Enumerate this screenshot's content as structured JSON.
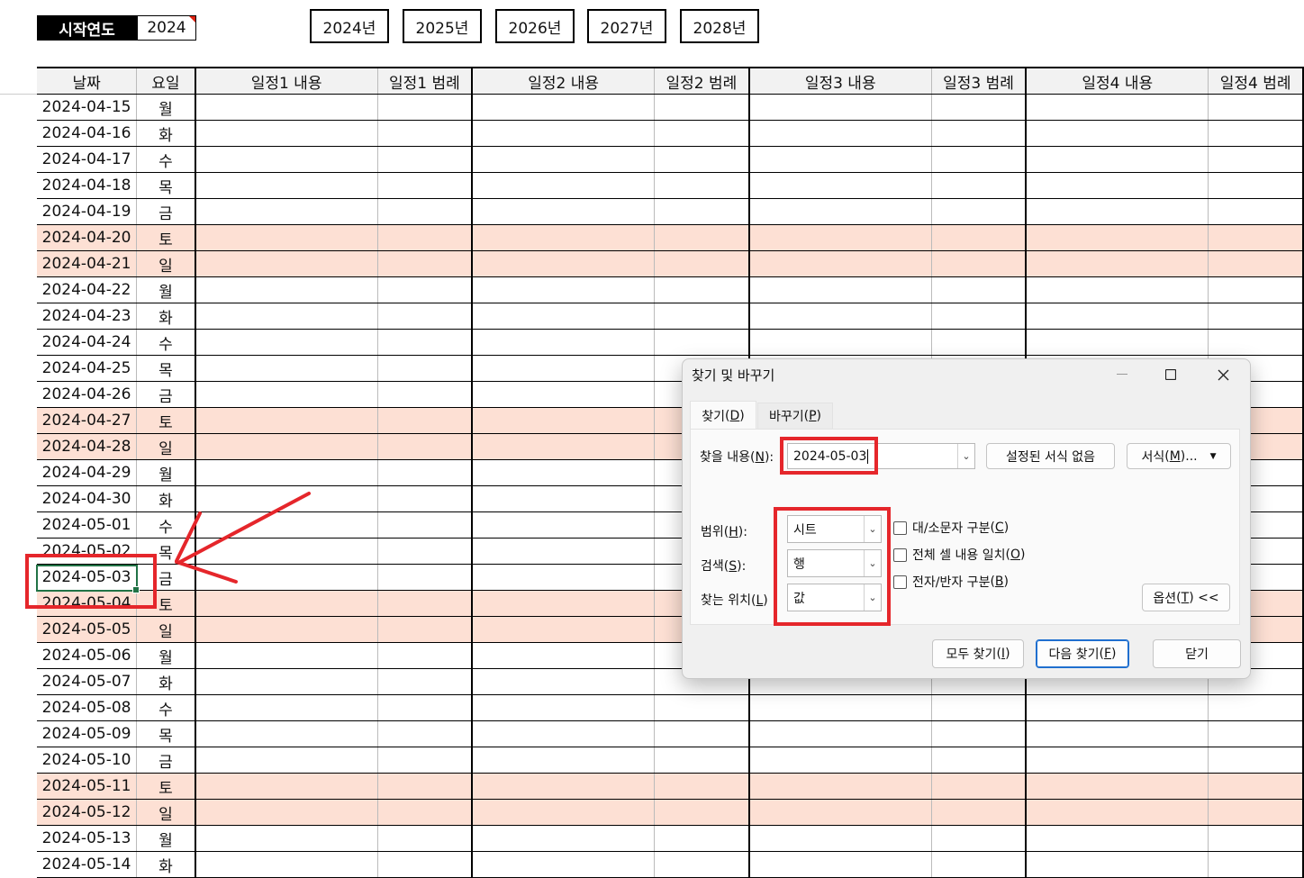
{
  "start_year": {
    "label": "시작연도",
    "value": "2024"
  },
  "year_buttons": [
    "2024년",
    "2025년",
    "2026년",
    "2027년",
    "2028년"
  ],
  "sheet": {
    "headers": [
      "날짜",
      "요일",
      "일정1 내용",
      "일정1 범례",
      "일정2 내용",
      "일정2 범례",
      "일정3 내용",
      "일정3 범례",
      "일정4 내용",
      "일정4 범례"
    ],
    "rows": [
      {
        "date": "2024-04-15",
        "day": "월",
        "weekend": false
      },
      {
        "date": "2024-04-16",
        "day": "화",
        "weekend": false
      },
      {
        "date": "2024-04-17",
        "day": "수",
        "weekend": false
      },
      {
        "date": "2024-04-18",
        "day": "목",
        "weekend": false
      },
      {
        "date": "2024-04-19",
        "day": "금",
        "weekend": false
      },
      {
        "date": "2024-04-20",
        "day": "토",
        "weekend": true
      },
      {
        "date": "2024-04-21",
        "day": "일",
        "weekend": true
      },
      {
        "date": "2024-04-22",
        "day": "월",
        "weekend": false
      },
      {
        "date": "2024-04-23",
        "day": "화",
        "weekend": false
      },
      {
        "date": "2024-04-24",
        "day": "수",
        "weekend": false
      },
      {
        "date": "2024-04-25",
        "day": "목",
        "weekend": false
      },
      {
        "date": "2024-04-26",
        "day": "금",
        "weekend": false
      },
      {
        "date": "2024-04-27",
        "day": "토",
        "weekend": true
      },
      {
        "date": "2024-04-28",
        "day": "일",
        "weekend": true
      },
      {
        "date": "2024-04-29",
        "day": "월",
        "weekend": false
      },
      {
        "date": "2024-04-30",
        "day": "화",
        "weekend": false
      },
      {
        "date": "2024-05-01",
        "day": "수",
        "weekend": false
      },
      {
        "date": "2024-05-02",
        "day": "목",
        "weekend": false
      },
      {
        "date": "2024-05-03",
        "day": "금",
        "weekend": false
      },
      {
        "date": "2024-05-04",
        "day": "토",
        "weekend": true
      },
      {
        "date": "2024-05-05",
        "day": "일",
        "weekend": true
      },
      {
        "date": "2024-05-06",
        "day": "월",
        "weekend": false
      },
      {
        "date": "2024-05-07",
        "day": "화",
        "weekend": false
      },
      {
        "date": "2024-05-08",
        "day": "수",
        "weekend": false
      },
      {
        "date": "2024-05-09",
        "day": "목",
        "weekend": false
      },
      {
        "date": "2024-05-10",
        "day": "금",
        "weekend": false
      },
      {
        "date": "2024-05-11",
        "day": "토",
        "weekend": true
      },
      {
        "date": "2024-05-12",
        "day": "일",
        "weekend": true
      },
      {
        "date": "2024-05-13",
        "day": "월",
        "weekend": false
      },
      {
        "date": "2024-05-14",
        "day": "화",
        "weekend": false
      }
    ]
  },
  "dialog": {
    "title": "찾기 및 바꾸기",
    "tabs": [
      {
        "label": "찾기",
        "key": "D"
      },
      {
        "label": "바꾸기",
        "key": "P"
      }
    ],
    "find_label": "찾을 내용",
    "find_key": "N",
    "find_value": "2024-05-03",
    "no_format_button": "설정된 서식 없음",
    "format_button": "서식",
    "format_key": "M",
    "format_suffix": "...",
    "scope_label": "범위",
    "scope_key": "H",
    "scope_value": "시트",
    "search_label": "검색",
    "search_key": "S",
    "search_value": "행",
    "lookin_label": "찾는 위치",
    "lookin_key": "L",
    "lookin_value": "값",
    "check_case": "대/소문자 구분",
    "check_case_key": "C",
    "check_whole": "전체 셀 내용 일치",
    "check_whole_key": "O",
    "check_width": "전자/반자 구분",
    "check_width_key": "B",
    "options_button": "옵션",
    "options_key": "T",
    "options_suffix": " <<",
    "find_all": "모두 찾기",
    "find_all_key": "I",
    "find_next": "다음 찾기",
    "find_next_key": "F",
    "close": "닫기"
  },
  "colors": {
    "weekend_bg": "#fde0d4",
    "annotation_red": "#e5262b",
    "selection_green": "#217346"
  }
}
